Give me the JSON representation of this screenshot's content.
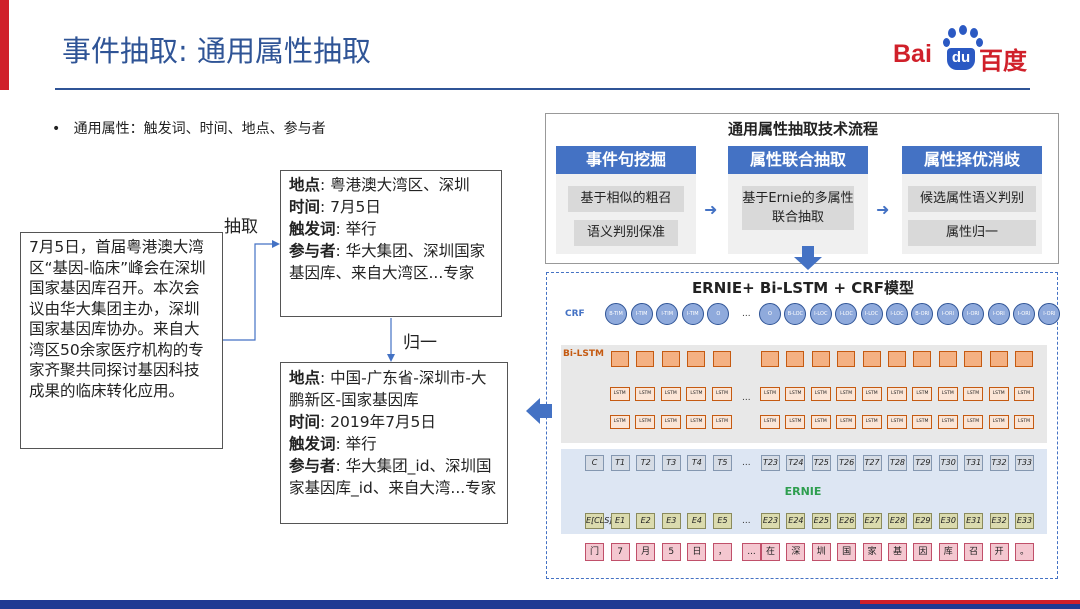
{
  "slide": {
    "title": "事件抽取: 通用属性抽取",
    "bullet": "通用属性：触发词、时间、地点、参与者",
    "logo": {
      "latin": "Bai",
      "badge": "du",
      "chinese": "百度"
    }
  },
  "source_text": "7月5日，首届粤港澳大湾区“基因-临床”峰会在深圳国家基因库召开。本次会议由华大集团主办，深圳国家基因库协办。来自大湾区50余家医疗机构的专家齐聚共同探讨基因科技成果的临床转化应用。",
  "labels": {
    "extract": "抽取",
    "normalize": "归一"
  },
  "result_raw": {
    "place_key": "地点",
    "place_val": ": 粤港澳大湾区、深圳",
    "time_key": "时间",
    "time_val": ": 7月5日",
    "trigger_key": "触发词",
    "trigger_val": ": 举行",
    "participant_key": "参与者",
    "participant_val": ": 华大集团、深圳国家基因库、来自大湾区...专家"
  },
  "result_norm": {
    "place_key": "地点",
    "place_val": ": 中国-广东省-深圳市-大鹏新区-国家基因库",
    "time_key": "时间",
    "time_val": ": 2019年7月5日",
    "trigger_key": "触发词",
    "trigger_val": ": 举行",
    "participant_key": "参与者",
    "participant_val": ": 华大集团_id、深圳国家基因库_id、来自大湾...专家"
  },
  "flow": {
    "title": "通用属性抽取技术流程",
    "stages": [
      {
        "head": "事件句挖掘",
        "items": [
          "基于相似的粗召",
          "语义判别保准"
        ]
      },
      {
        "head": "属性联合抽取",
        "items": [
          "基于Ernie的多属性联合抽取"
        ]
      },
      {
        "head": "属性择优消歧",
        "items": [
          "候选属性语义判别",
          "属性归一"
        ]
      }
    ]
  },
  "model": {
    "title": "ERNIE+ Bi-LSTM + CRF模型",
    "crf_label": "CRF",
    "bilstm_label": "Bi-LSTM",
    "ernie_label": "ERNIE",
    "lstm_text": "LSTM",
    "ellipsis": "...",
    "crf_tags": [
      "B-TIM",
      "I-TIM",
      "I-TIM",
      "I-TIM",
      "O",
      "O",
      "B-LOC",
      "I-LOC",
      "I-LOC",
      "I-LOC",
      "I-LOC",
      "B-ORI",
      "I-ORI",
      "I-ORI"
    ],
    "tokens": [
      "C",
      "T1",
      "T2",
      "T3",
      "T4",
      "T5",
      "T23",
      "T24",
      "T25",
      "T26",
      "T27",
      "T28",
      "T29",
      "T30",
      "T31",
      "T32",
      "T33"
    ],
    "embeds": [
      "E[CLS]",
      "E1",
      "E2",
      "E3",
      "E4",
      "E5",
      "E23",
      "E24",
      "E25",
      "E26",
      "E27",
      "E28",
      "E29",
      "E30",
      "E31",
      "E32",
      "E33"
    ],
    "chars": [
      "门",
      "7",
      "月",
      "5",
      "日",
      "，",
      "...",
      "在",
      "深",
      "圳",
      "国",
      "家",
      "基",
      "因",
      "库",
      "召",
      "开",
      "。"
    ]
  }
}
